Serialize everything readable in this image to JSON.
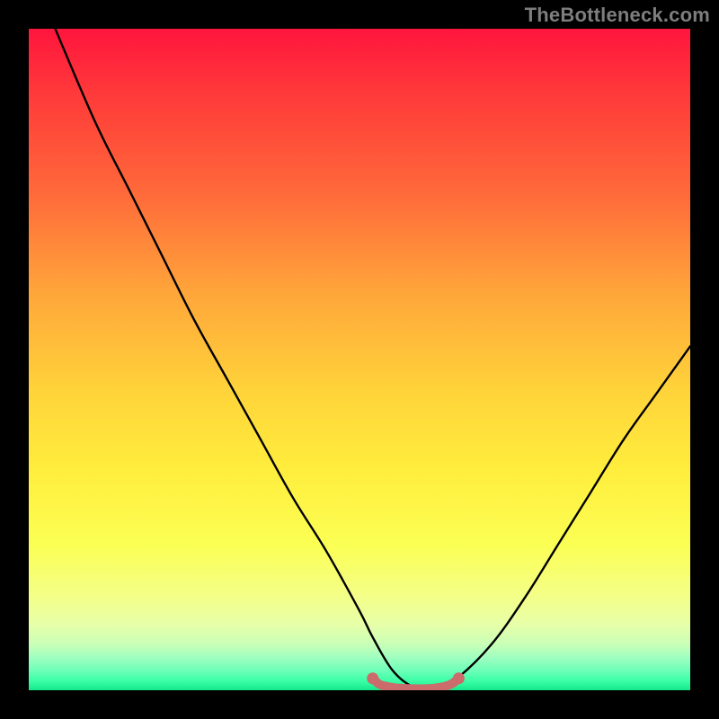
{
  "watermark": {
    "text": "TheBottleneck.com"
  },
  "colors": {
    "background": "#000000",
    "curve": "#000000",
    "marker": "#cb6b6b",
    "gradient_top": "#ff153d",
    "gradient_mid": "#ffd43a",
    "gradient_bottom": "#14e88a"
  },
  "chart_data": {
    "type": "line",
    "title": "",
    "xlabel": "",
    "ylabel": "",
    "xlim": [
      0,
      100
    ],
    "ylim": [
      0,
      100
    ],
    "legend": false,
    "grid": false,
    "series": [
      {
        "name": "curve",
        "x": [
          4,
          10,
          15,
          20,
          25,
          30,
          35,
          40,
          45,
          50,
          52,
          55,
          58,
          60,
          62,
          65,
          70,
          75,
          80,
          85,
          90,
          95,
          100
        ],
        "y": [
          100,
          86,
          76,
          66,
          56,
          47,
          38,
          29,
          21,
          12,
          8,
          3,
          0.5,
          0,
          0.4,
          2,
          7,
          14,
          22,
          30,
          38,
          45,
          52
        ]
      }
    ],
    "markers": {
      "name": "floor-band",
      "color": "#cb6b6b",
      "x": [
        52,
        53,
        54,
        55,
        56,
        57,
        58,
        59,
        60,
        61,
        62,
        63,
        64,
        65
      ],
      "y": [
        1.8,
        0.9,
        0.6,
        0.4,
        0.3,
        0.25,
        0.22,
        0.2,
        0.22,
        0.28,
        0.4,
        0.6,
        1.0,
        1.8
      ]
    }
  }
}
